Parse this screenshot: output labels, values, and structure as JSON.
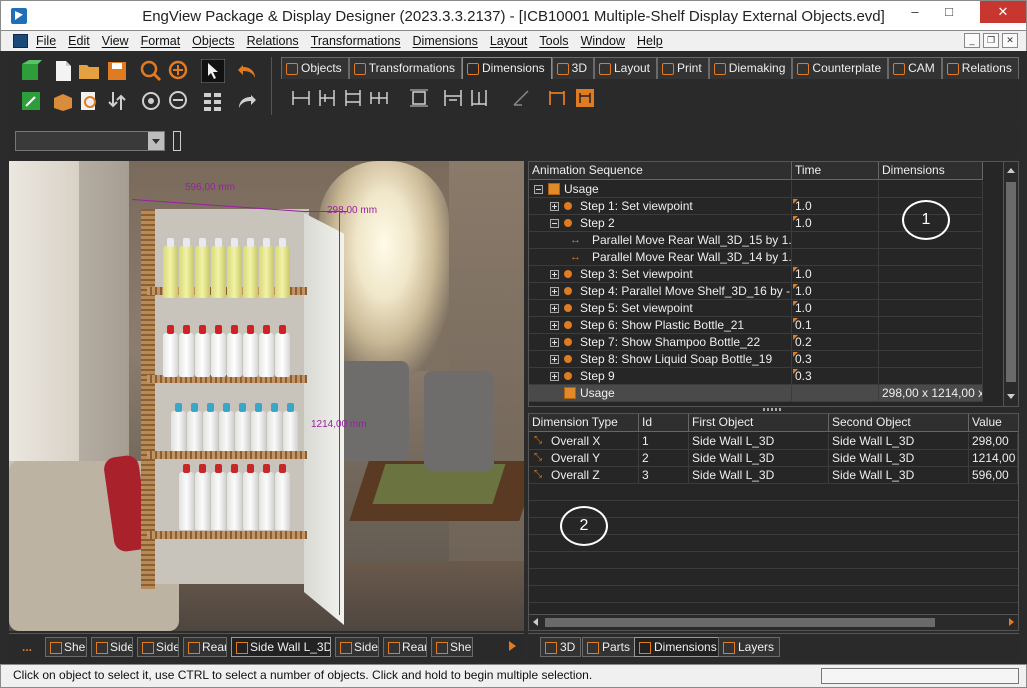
{
  "window": {
    "title": "EngView Package & Display Designer (2023.3.3.2137) - [ICB10001 Multiple-Shelf Display External Objects.evd]",
    "minimize": "–",
    "maximize": "□",
    "close": "✕"
  },
  "menu": {
    "items": [
      "File",
      "Edit",
      "View",
      "Format",
      "Objects",
      "Relations",
      "Transformations",
      "Dimensions",
      "Layout",
      "Tools",
      "Window",
      "Help"
    ],
    "mdi_min": "_",
    "mdi_restore": "❐",
    "mdi_close": "✕"
  },
  "ribbon": {
    "tabs": [
      "Objects",
      "Transformations",
      "Dimensions",
      "3D",
      "Layout",
      "Print",
      "Diemaking",
      "Counterplate",
      "CAM",
      "Relations"
    ],
    "active_tab": "Dimensions"
  },
  "viewport": {
    "dimensions": {
      "width_label": "596,00 mm",
      "depth_label": "298,00 mm",
      "height_label": "1214,00 mm"
    },
    "tabs_more": "...",
    "tabs": [
      "Shelf",
      "Side",
      "Side",
      "Rear",
      "Side Wall L_3D",
      "Side",
      "Rear",
      "Shel"
    ],
    "active_tab": "Side Wall L_3D"
  },
  "animation": {
    "headers": [
      "Animation Sequence",
      "Time",
      "Dimensions"
    ],
    "rows": [
      {
        "label": "Usage",
        "time": "",
        "dims": "",
        "level": 0,
        "expander": "minus",
        "icon": "box"
      },
      {
        "label": "Step 1: Set viewpoint",
        "time": "1.0",
        "dims": "",
        "level": 1,
        "expander": "plus",
        "icon": "dot"
      },
      {
        "label": "Step 2",
        "time": "1.0",
        "dims": "",
        "level": 1,
        "expander": "minus",
        "icon": "dot"
      },
      {
        "label": "Parallel Move Rear Wall_3D_15 by 1...",
        "time": "",
        "dims": "",
        "level": 2,
        "expander": "",
        "icon": "move"
      },
      {
        "label": "Parallel Move Rear Wall_3D_14 by 1...",
        "time": "",
        "dims": "",
        "level": 2,
        "expander": "",
        "icon": "move"
      },
      {
        "label": "Step 3: Set viewpoint",
        "time": "1.0",
        "dims": "",
        "level": 1,
        "expander": "plus",
        "icon": "dot"
      },
      {
        "label": "Step 4: Parallel Move Shelf_3D_16 by -...",
        "time": "1.0",
        "dims": "",
        "level": 1,
        "expander": "plus",
        "icon": "dot"
      },
      {
        "label": "Step 5: Set viewpoint",
        "time": "1.0",
        "dims": "",
        "level": 1,
        "expander": "plus",
        "icon": "dot"
      },
      {
        "label": "Step 6: Show Plastic Bottle_21",
        "time": "0.1",
        "dims": "",
        "level": 1,
        "expander": "plus",
        "icon": "dot"
      },
      {
        "label": "Step 7: Show Shampoo Bottle_22",
        "time": "0.2",
        "dims": "",
        "level": 1,
        "expander": "plus",
        "icon": "dot"
      },
      {
        "label": "Step 8: Show Liquid Soap Bottle_19",
        "time": "0.3",
        "dims": "",
        "level": 1,
        "expander": "plus",
        "icon": "dot"
      },
      {
        "label": "Step 9",
        "time": "0.3",
        "dims": "",
        "level": 1,
        "expander": "plus",
        "icon": "dot"
      },
      {
        "label": "Usage",
        "time": "",
        "dims": "298,00 x 1214,00 x...",
        "level": 1,
        "expander": "",
        "icon": "box",
        "selected": true
      }
    ],
    "callout": "1"
  },
  "dimensions_table": {
    "headers": [
      "Dimension Type",
      "Id",
      "First Object",
      "Second Object",
      "Value"
    ],
    "rows": [
      {
        "type": "Overall X",
        "id": "1",
        "first": "Side Wall L_3D",
        "second": "Side Wall L_3D",
        "value": "298,00"
      },
      {
        "type": "Overall Y",
        "id": "2",
        "first": "Side Wall L_3D",
        "second": "Side Wall L_3D",
        "value": "1214,00"
      },
      {
        "type": "Overall Z",
        "id": "3",
        "first": "Side Wall L_3D",
        "second": "Side Wall L_3D",
        "value": "596,00"
      }
    ],
    "callout": "2"
  },
  "bottom_tabs": [
    "3D",
    "Parts",
    "Dimensions",
    "Layers"
  ],
  "bottom_active_tab": "Dimensions",
  "status": {
    "text": "Click on object to select it, use CTRL to select a number of objects. Click and hold to begin multiple selection."
  }
}
